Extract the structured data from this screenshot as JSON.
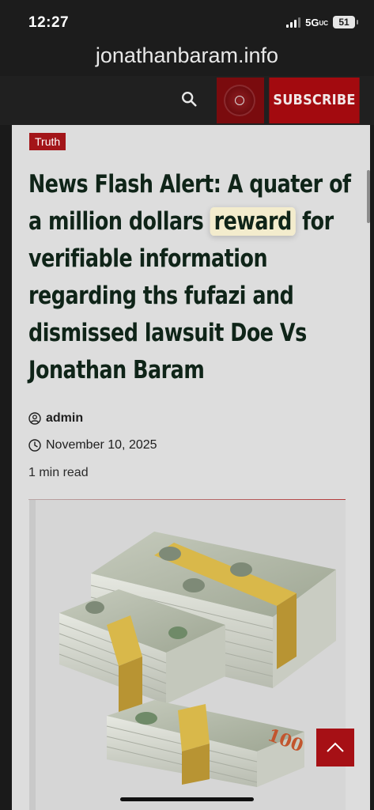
{
  "status_bar": {
    "time": "12:27",
    "network": "5G",
    "network_suffix": "UC",
    "battery": "51"
  },
  "browser": {
    "url": "jonathanbaram.info"
  },
  "header": {
    "subscribe_label": "SUBSCRIBE",
    "accent_color": "#a30a0f"
  },
  "article": {
    "category": "Truth",
    "title_lines": [
      "News Flash Alert: A quater of",
      "a million dollars",
      "reward",
      "for",
      "verifiable information",
      "regarding ths fufazi and",
      "dismissed lawsuit Doe Vs",
      "Jonathan Baram"
    ],
    "author": "admin",
    "date": "November 10, 2025",
    "read_time": "1 min read"
  },
  "icons": {
    "search": "search-icon",
    "live": "live-radio-icon",
    "author": "user-icon",
    "date": "clock-icon",
    "back_to_top": "chevron-up-icon"
  }
}
